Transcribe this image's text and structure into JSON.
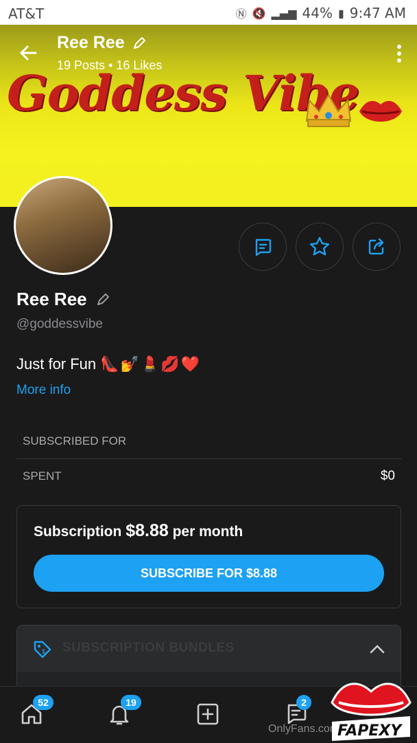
{
  "status_bar": {
    "carrier": "AT&T",
    "battery": "44%",
    "time": "9:47 AM"
  },
  "header": {
    "title": "Ree Ree",
    "stats": "19 Posts • 16 Likes"
  },
  "banner": {
    "brand_text": "Goddess Vibe",
    "bg_color": "#f3ef21",
    "text_color": "#c4201b"
  },
  "profile": {
    "name": "Ree Ree",
    "handle": "@goddessvibe",
    "bio": "Just for Fun",
    "bio_emoji": "👠💅💄💋❤️",
    "more_info": "More info"
  },
  "actions": {
    "icons": [
      "message-icon",
      "star-icon",
      "share-icon"
    ]
  },
  "details": {
    "subscribed_for_label": "SUBSCRIBED FOR",
    "spent_label": "SPENT",
    "spent_value": "$0"
  },
  "subscription": {
    "prefix": "Subscription",
    "price": "$8.88",
    "suffix": "per month",
    "button_label": "SUBSCRIBE FOR $8.88"
  },
  "promo": {
    "title": "SUBSCRIPTION BUNDLES"
  },
  "tabbar": {
    "home_badge": "52",
    "notifications_badge": "19",
    "messages_badge": "2"
  },
  "watermark": {
    "text": "OnlyFans.com/j...ny20",
    "logo_text": "FAPEXY"
  },
  "colors": {
    "accent": "#1da1f2",
    "background": "#1a1a1b"
  }
}
